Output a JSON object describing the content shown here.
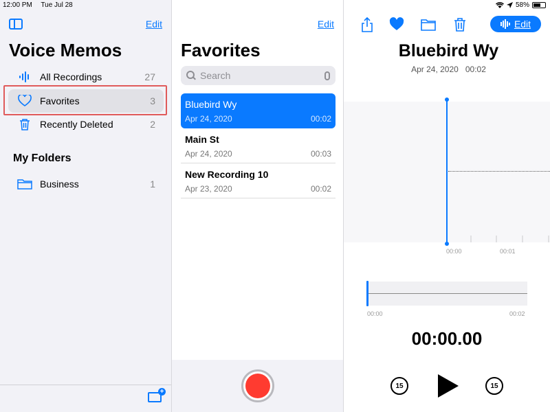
{
  "status_bar": {
    "time": "12:00 PM",
    "date": "Tue Jul 28",
    "battery": "58%",
    "battery_level": 0.58
  },
  "sidebar": {
    "edit_label": "Edit",
    "title": "Voice Memos",
    "items": [
      {
        "label": "All Recordings",
        "count": "27",
        "icon": "waveform-icon"
      },
      {
        "label": "Favorites",
        "count": "3",
        "icon": "heart-icon"
      },
      {
        "label": "Recently Deleted",
        "count": "2",
        "icon": "trash-icon"
      }
    ],
    "folders_title": "My Folders",
    "folders": [
      {
        "label": "Business",
        "count": "1",
        "icon": "folder-icon"
      }
    ]
  },
  "list": {
    "edit_label": "Edit",
    "title": "Favorites",
    "search_placeholder": "Search",
    "recordings": [
      {
        "name": "Bluebird Wy",
        "date": "Apr 24, 2020",
        "duration": "00:02"
      },
      {
        "name": "Main St",
        "date": "Apr 24, 2020",
        "duration": "00:03"
      },
      {
        "name": "New Recording 10",
        "date": "Apr 23, 2020",
        "duration": "00:02"
      }
    ]
  },
  "detail": {
    "edit_label": "Edit",
    "title": "Bluebird Wy",
    "date": "Apr 24, 2020",
    "duration": "00:02",
    "wave_ticks": [
      "00:00",
      "00:01"
    ],
    "mini_start": "00:00",
    "mini_end": "00:02",
    "timer": "00:00.00",
    "skip_back": "15",
    "skip_forward": "15"
  },
  "colors": {
    "accent": "#0a7aff",
    "record": "#ff3b30",
    "highlight": "#e05a5a"
  }
}
